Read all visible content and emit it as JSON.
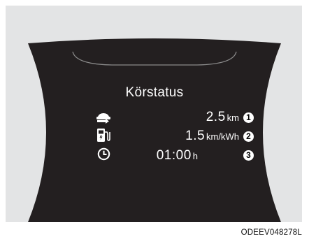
{
  "screen": {
    "title": "Körstatus"
  },
  "rows": [
    {
      "icon": "distance-icon",
      "value": "2.5",
      "unit": "km",
      "callout": "1"
    },
    {
      "icon": "ev-charger-icon",
      "value": "1.5",
      "unit": "km/kWh",
      "callout": "2"
    },
    {
      "icon": "clock-icon",
      "value": "01:00",
      "unit": "h",
      "callout": "3"
    }
  ],
  "figure_code": "ODEEV048278L",
  "colors": {
    "cluster_body": "#231f20",
    "figure_background": "#e3e4e5",
    "text": "#ffffff"
  }
}
